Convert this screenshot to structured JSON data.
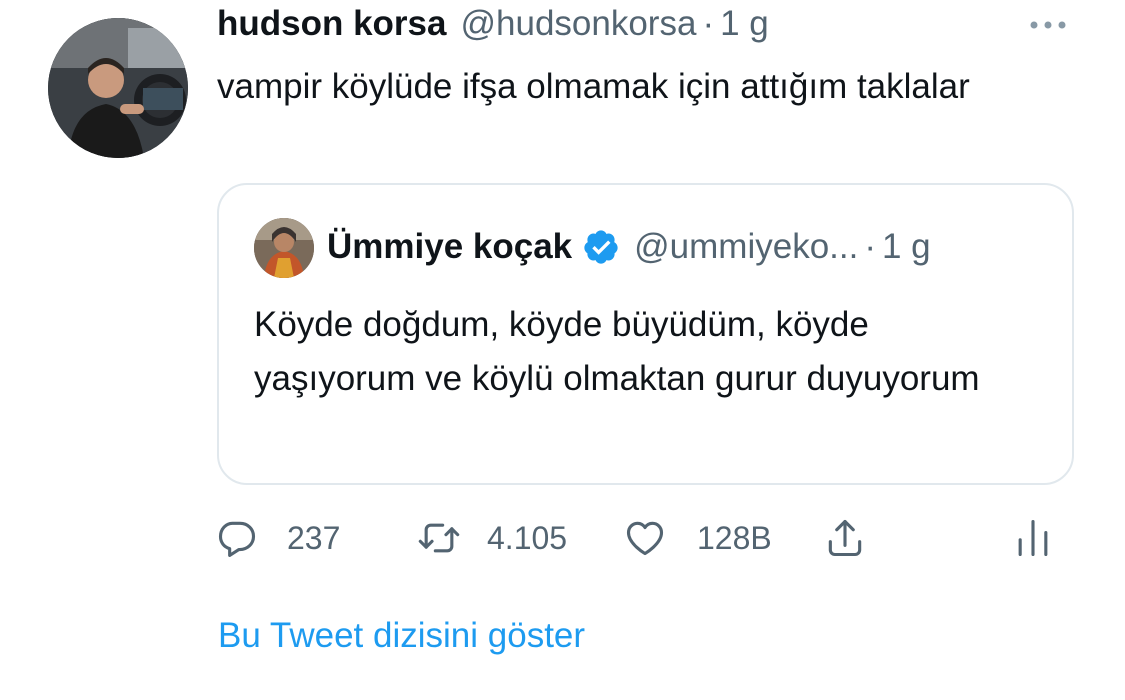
{
  "tweet": {
    "author_name": "hudson korsa",
    "author_handle": "@hudsonkorsa",
    "separator": "·",
    "time": "1 g",
    "text": "vampir köylüde ifşa olmamak için attığım taklalar",
    "more_icon": "more-horizontal-icon"
  },
  "quoted_tweet": {
    "author_name": "Ümmiye koçak",
    "verified_icon": "verified-badge-icon",
    "author_handle": "@ummiyeko...",
    "separator": "·",
    "time": "1 g",
    "text": "Köyde doğdum, köyde büyüdüm, köyde yaşıyorum ve köylü olmaktan gurur duyuyorum"
  },
  "actions": {
    "reply": {
      "icon": "reply-icon",
      "count": "237"
    },
    "retweet": {
      "icon": "retweet-icon",
      "count": "4.105"
    },
    "like": {
      "icon": "heart-icon",
      "count": "128B"
    },
    "share": {
      "icon": "share-icon"
    },
    "analytics": {
      "icon": "analytics-icon"
    }
  },
  "show_thread_label": "Bu Tweet dizisini göster",
  "colors": {
    "text": "#0f1419",
    "secondary": "#536471",
    "link": "#1d9bf0",
    "verified": "#1d9bf0",
    "border": "#e1e8ed"
  }
}
